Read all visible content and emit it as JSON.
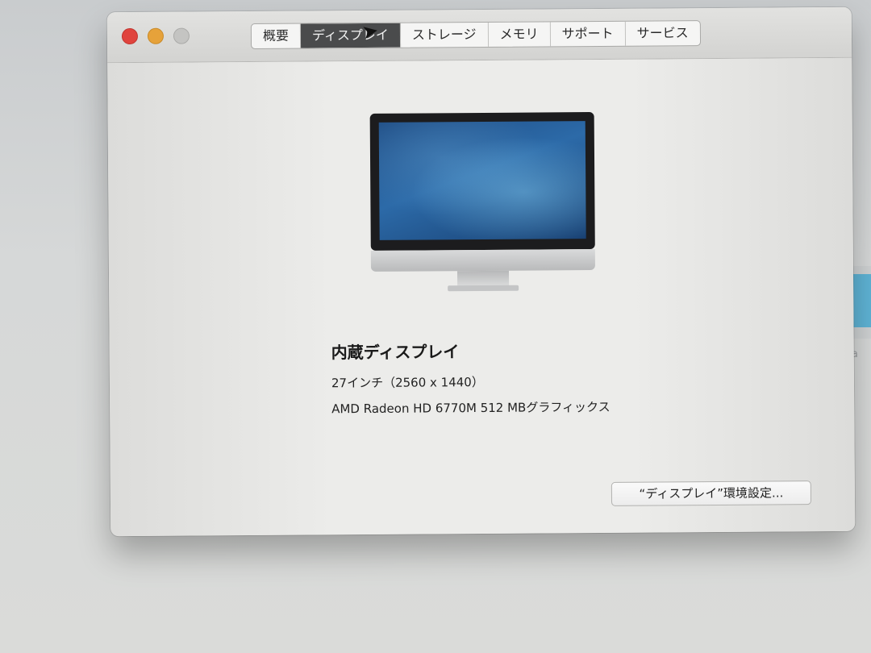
{
  "window": {
    "tabs": [
      {
        "label": "概要",
        "active": false
      },
      {
        "label": "ディスプレイ",
        "active": true
      },
      {
        "label": "ストレージ",
        "active": false
      },
      {
        "label": "メモリ",
        "active": false
      },
      {
        "label": "サポート",
        "active": false
      },
      {
        "label": "サービス",
        "active": false
      }
    ]
  },
  "display": {
    "title": "内蔵ディスプレイ",
    "size": "27インチ（2560 x 1440）",
    "graphics": "AMD Radeon HD 6770M 512 MBグラフィックス",
    "prefs_button_label": "“ディスプレイ”環境設定..."
  },
  "background": {
    "partial_text": "hla"
  },
  "colors": {
    "close": "#e0443e",
    "minimize": "#e6a23a",
    "zoom_disabled": "#c4c4c2",
    "active_tab": "#4a4b4c",
    "accent_background": "#5fb4d6"
  },
  "icons": [
    "close-icon",
    "minimize-icon",
    "zoom-icon",
    "apple-logo-icon",
    "pointer-cursor-icon"
  ]
}
